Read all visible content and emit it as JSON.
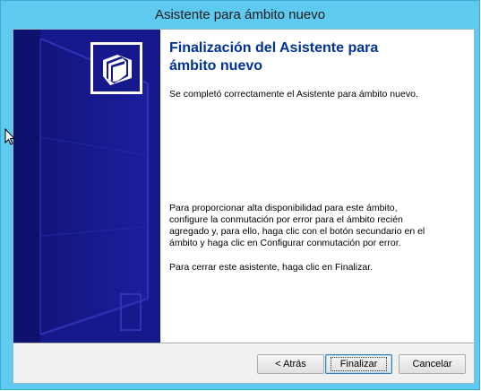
{
  "window": {
    "title": "Asistente para ámbito nuevo"
  },
  "page": {
    "heading_line1": "Finalización del Asistente para",
    "heading_line2": "ámbito nuevo",
    "success_text": "Se completó correctamente el Asistente para ámbito nuevo.",
    "failover_lines": [
      "Para proporcionar alta disponibilidad para este ámbito,",
      "configure la conmutación por error para el ámbito recién",
      "agregado y, para ello, haga clic con el botón secundario en el",
      "ámbito y haga clic en Configurar conmutación por error."
    ],
    "close_text": "Para cerrar este asistente, haga clic en Finalizar."
  },
  "buttons": {
    "back_label": "< Atrás",
    "finish_label": "Finalizar",
    "cancel_label": "Cancelar"
  },
  "icons": {
    "wizard": "folders-icon",
    "cursor": "mouse-pointer-icon"
  },
  "colors": {
    "frame": "#5fcaef",
    "banner": "#16198c",
    "heading": "#003399"
  }
}
